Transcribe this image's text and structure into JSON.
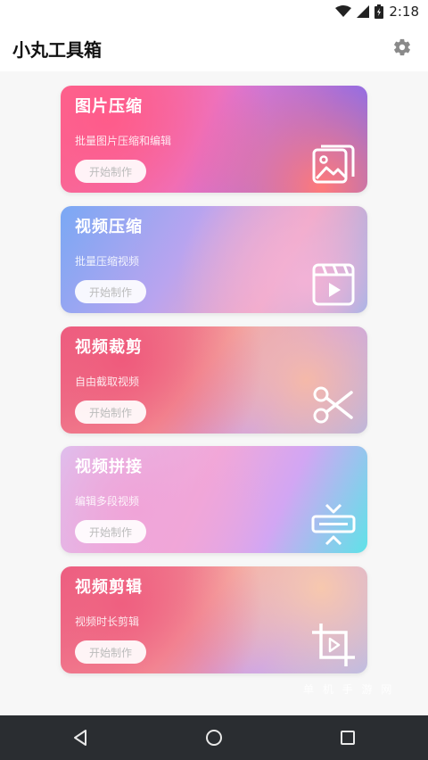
{
  "status_bar": {
    "time": "2:18",
    "icons": [
      "wifi-icon",
      "signal-icon",
      "battery-icon"
    ]
  },
  "app": {
    "title": "小丸工具箱",
    "settings_icon": "gear-icon"
  },
  "cards": [
    {
      "title": "图片压缩",
      "description": "批量图片压缩和编辑",
      "button_label": "开始制作",
      "icon": "image-gallery-icon"
    },
    {
      "title": "视频压缩",
      "description": "批量压缩视频",
      "button_label": "开始制作",
      "icon": "video-player-icon"
    },
    {
      "title": "视频裁剪",
      "description": "自由截取视频",
      "button_label": "开始制作",
      "icon": "scissors-icon"
    },
    {
      "title": "视频拼接",
      "description": "编辑多段视频",
      "button_label": "开始制作",
      "icon": "merge-icon"
    },
    {
      "title": "视频剪辑",
      "description": "视频时长剪辑",
      "button_label": "开始制作",
      "icon": "crop-play-icon"
    }
  ],
  "watermark": "单 机 手 游 网",
  "nav": {
    "back_icon": "back-triangle-icon",
    "home_icon": "home-circle-icon",
    "recents_icon": "recents-square-icon"
  },
  "colors": {
    "status_bar_bg": "#ffffff",
    "page_bg": "#f7f7f7",
    "nav_bg": "#2a2d31"
  }
}
